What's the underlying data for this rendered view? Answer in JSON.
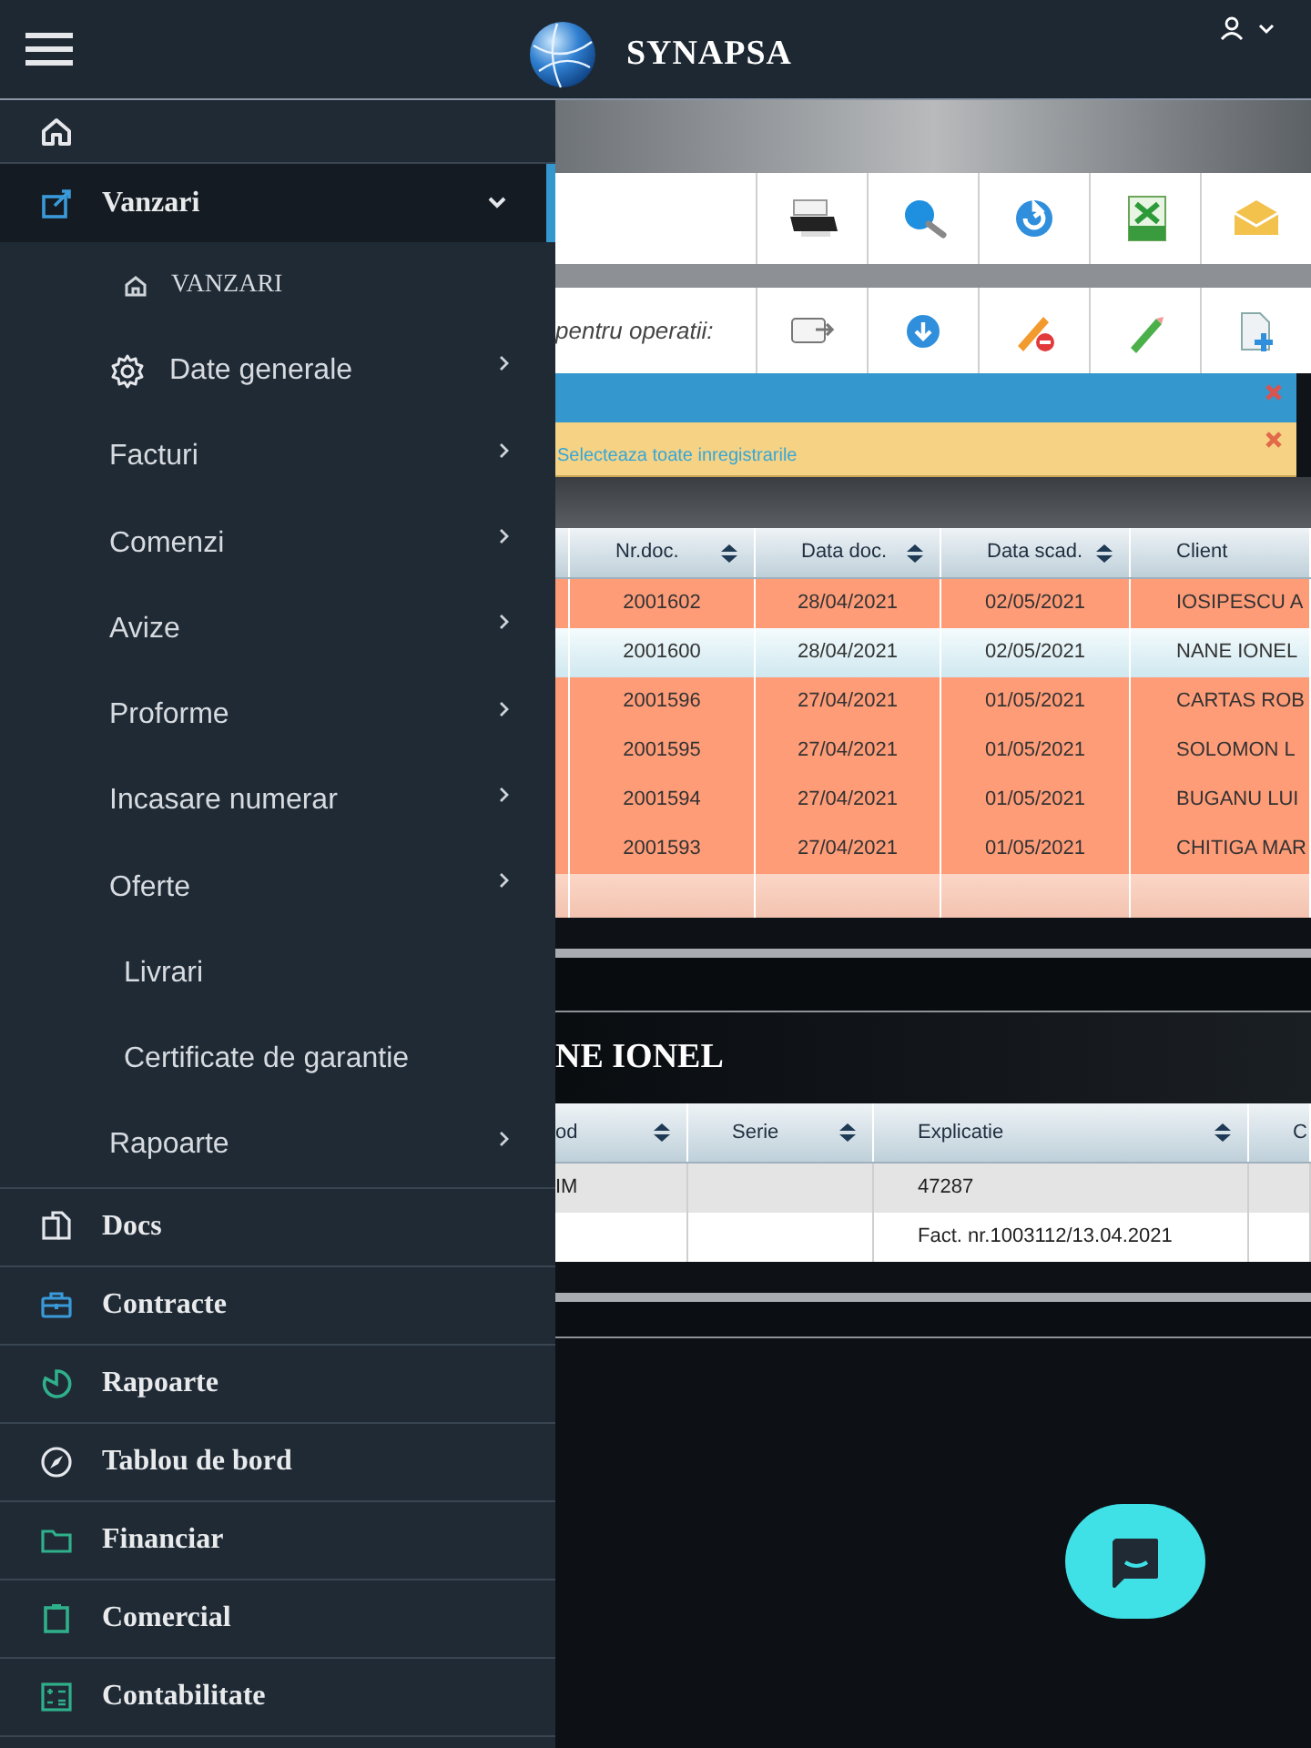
{
  "header": {
    "brand": "SYNAPSA"
  },
  "sidebar": {
    "items": [
      {
        "label": "Vanzari",
        "expanded": true,
        "children": [
          {
            "label": "VANZARI",
            "kind": "title",
            "has_submenu": false
          },
          {
            "label": "Date generale",
            "kind": "settings",
            "has_submenu": true
          },
          {
            "label": "Facturi",
            "kind": "plain",
            "has_submenu": true
          },
          {
            "label": "Comenzi",
            "kind": "plain",
            "has_submenu": true
          },
          {
            "label": "Avize",
            "kind": "plain",
            "has_submenu": true
          },
          {
            "label": "Proforme",
            "kind": "plain",
            "has_submenu": true
          },
          {
            "label": "Incasare numerar",
            "kind": "plain",
            "has_submenu": true
          },
          {
            "label": "Oferte",
            "kind": "plain",
            "has_submenu": true
          },
          {
            "label": "Livrari",
            "kind": "plain",
            "has_submenu": false
          },
          {
            "label": "Certificate de garantie",
            "kind": "plain",
            "has_submenu": false
          },
          {
            "label": "Rapoarte",
            "kind": "plain",
            "has_submenu": true
          }
        ]
      },
      {
        "label": "Docs",
        "expanded": false
      },
      {
        "label": "Contracte",
        "expanded": false
      },
      {
        "label": "Rapoarte",
        "expanded": false
      },
      {
        "label": "Tablou de bord",
        "expanded": false
      },
      {
        "label": "Financiar",
        "expanded": false
      },
      {
        "label": "Comercial",
        "expanded": false
      },
      {
        "label": "Contabilitate",
        "expanded": false
      }
    ]
  },
  "operations_toolbar": {
    "label": "pentru operatii:"
  },
  "alert": {
    "text": "Selecteaza toate inregistrarile"
  },
  "documents_table": {
    "columns": [
      "Nr.doc.",
      "Data doc.",
      "Data scad.",
      "Client"
    ],
    "rows": [
      {
        "cells": [
          "2001602",
          "28/04/2021",
          "02/05/2021",
          "IOSIPESCU A"
        ],
        "selected": false
      },
      {
        "cells": [
          "2001600",
          "28/04/2021",
          "02/05/2021",
          "NANE IONEL"
        ],
        "selected": true
      },
      {
        "cells": [
          "2001596",
          "27/04/2021",
          "01/05/2021",
          "CARTAS ROB"
        ],
        "selected": false
      },
      {
        "cells": [
          "2001595",
          "27/04/2021",
          "01/05/2021",
          "SOLOMON L"
        ],
        "selected": false
      },
      {
        "cells": [
          "2001594",
          "27/04/2021",
          "01/05/2021",
          "BUGANU LUI"
        ],
        "selected": false
      },
      {
        "cells": [
          "2001593",
          "27/04/2021",
          "01/05/2021",
          "CHITIGA MAR"
        ],
        "selected": false
      }
    ]
  },
  "detail": {
    "title": "NE IONEL",
    "columns": [
      "od",
      "Serie",
      "Explicatie",
      "C"
    ],
    "rows": [
      {
        "cells": [
          "IM",
          "",
          "47287",
          ""
        ]
      },
      {
        "cells": [
          "",
          "",
          "Fact. nr.1003112/13.04.2021",
          ""
        ]
      }
    ]
  }
}
